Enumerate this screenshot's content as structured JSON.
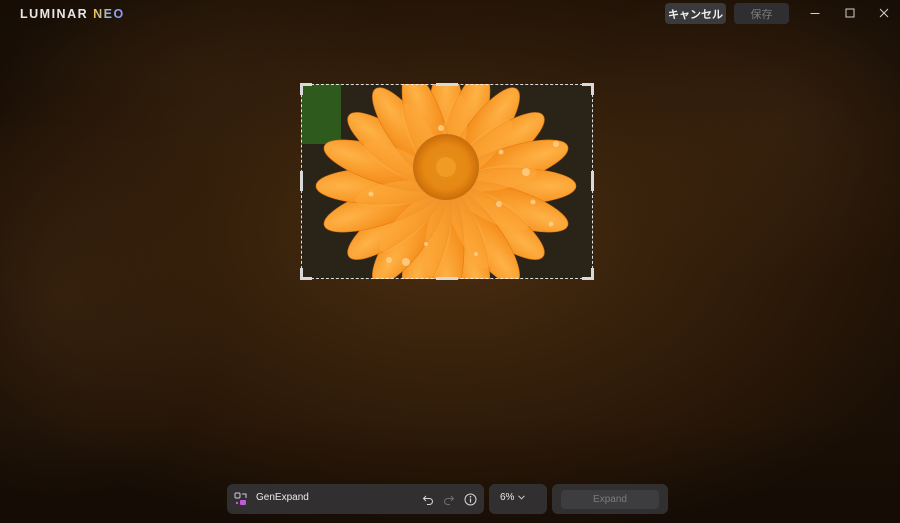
{
  "app": {
    "logo_main": "LUMINAR ",
    "logo_accent": "NEO"
  },
  "titlebar": {
    "cancel_label": "キャンセル",
    "save_label": "保存",
    "minimize_icon": "minimize-icon",
    "maximize_icon": "maximize-icon",
    "close_icon": "close-icon"
  },
  "canvas": {
    "image_subject": "orange flower with water droplets"
  },
  "toolbar": {
    "tool_name": "GenExpand",
    "tool_icon": "genexpand-icon",
    "undo_icon": "undo-icon",
    "redo_icon": "redo-icon",
    "info_icon": "info-icon",
    "zoom_value": "6%",
    "zoom_chevron": "chevron-down-icon",
    "expand_label": "Expand"
  },
  "colors": {
    "accent_pink": "#c05ad6",
    "panel_bg": "#343234",
    "photo_orange": "#f0861a"
  }
}
